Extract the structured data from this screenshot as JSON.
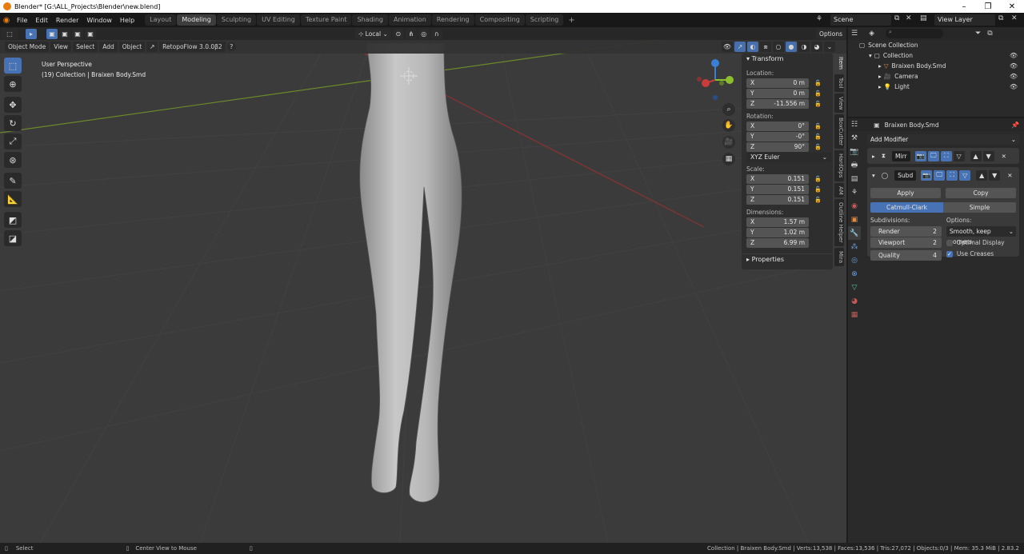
{
  "window": {
    "title": "Blender* [G:\\ALL_Projects\\Blender\\new.blend]"
  },
  "menu": [
    "File",
    "Edit",
    "Render",
    "Window",
    "Help"
  ],
  "workspaces": [
    {
      "label": "Layout",
      "active": false
    },
    {
      "label": "Modeling",
      "active": true
    },
    {
      "label": "Sculpting",
      "active": false
    },
    {
      "label": "UV Editing",
      "active": false
    },
    {
      "label": "Texture Paint",
      "active": false
    },
    {
      "label": "Shading",
      "active": false
    },
    {
      "label": "Animation",
      "active": false
    },
    {
      "label": "Rendering",
      "active": false
    },
    {
      "label": "Compositing",
      "active": false
    },
    {
      "label": "Scripting",
      "active": false
    }
  ],
  "scene": {
    "name": "Scene",
    "view_layer": "View Layer"
  },
  "header": {
    "transform_orientation": "Local",
    "options": "Options"
  },
  "header2": {
    "mode": "Object Mode",
    "view": "View",
    "select": "Select",
    "add": "Add",
    "object": "Object",
    "addon": "RetopoFlow 3.0.0β2"
  },
  "overlay_text": {
    "perspective": "User Perspective",
    "collection": "(19) Collection | Braixen Body.Smd"
  },
  "npanel": {
    "title": "Transform",
    "location_label": "Location:",
    "location": [
      {
        "axis": "X",
        "value": "0 m"
      },
      {
        "axis": "Y",
        "value": "0 m"
      },
      {
        "axis": "Z",
        "value": "-11.556 m"
      }
    ],
    "rotation_label": "Rotation:",
    "rotation": [
      {
        "axis": "X",
        "value": "0°"
      },
      {
        "axis": "Y",
        "value": "-0°"
      },
      {
        "axis": "Z",
        "value": "90°"
      }
    ],
    "rotation_mode": "XYZ Euler",
    "scale_label": "Scale:",
    "scale": [
      {
        "axis": "X",
        "value": "0.151"
      },
      {
        "axis": "Y",
        "value": "0.151"
      },
      {
        "axis": "Z",
        "value": "0.151"
      }
    ],
    "dimensions_label": "Dimensions:",
    "dimensions": [
      {
        "axis": "X",
        "value": "1.57 m"
      },
      {
        "axis": "Y",
        "value": "1.02 m"
      },
      {
        "axis": "Z",
        "value": "6.99 m"
      }
    ],
    "properties": "Properties"
  },
  "side_tabs": [
    {
      "label": "Item",
      "active": true
    },
    {
      "label": "Tool",
      "active": false
    },
    {
      "label": "View",
      "active": false
    },
    {
      "label": "BoxCutter",
      "active": false
    },
    {
      "label": "HardOps",
      "active": false
    },
    {
      "label": "AM",
      "active": false
    },
    {
      "label": "Outline Helper",
      "active": false
    },
    {
      "label": "Mira",
      "active": false
    }
  ],
  "outliner": {
    "root": "Scene Collection",
    "items": [
      {
        "label": "Collection",
        "indent": 1
      },
      {
        "label": "Braixen Body.Smd",
        "indent": 2
      },
      {
        "label": "Camera",
        "indent": 2
      },
      {
        "label": "Light",
        "indent": 2
      }
    ]
  },
  "properties": {
    "object_name": "Braixen Body.Smd",
    "add_modifier": "Add Modifier",
    "modifiers": [
      {
        "short": "Mirr"
      },
      {
        "short": "Subd"
      }
    ],
    "apply": "Apply",
    "copy": "Copy",
    "catmull": "Catmull-Clark",
    "simple": "Simple",
    "subdivisions_label": "Subdivisions:",
    "options_label": "Options:",
    "render": {
      "label": "Render",
      "value": "2"
    },
    "viewport": {
      "label": "Viewport",
      "value": "2"
    },
    "quality": {
      "label": "Quality",
      "value": "4"
    },
    "uv_smooth": "Smooth, keep corners",
    "optimal_display": "Optimal Display",
    "use_creases": "Use Creases"
  },
  "status": {
    "left": "Select",
    "mid": "Center View to Mouse",
    "right": "Collection | Braixen Body.Smd | Verts:13,538 | Faces:13,536 | Tris:27,072 | Objects:0/3 | Mem: 35.3 MiB | 2.83.2"
  },
  "colors": {
    "accent": "#4772b3",
    "x_axis": "#c93c3c",
    "y_axis": "#8bbf2e",
    "z_axis": "#3a7fd6"
  }
}
